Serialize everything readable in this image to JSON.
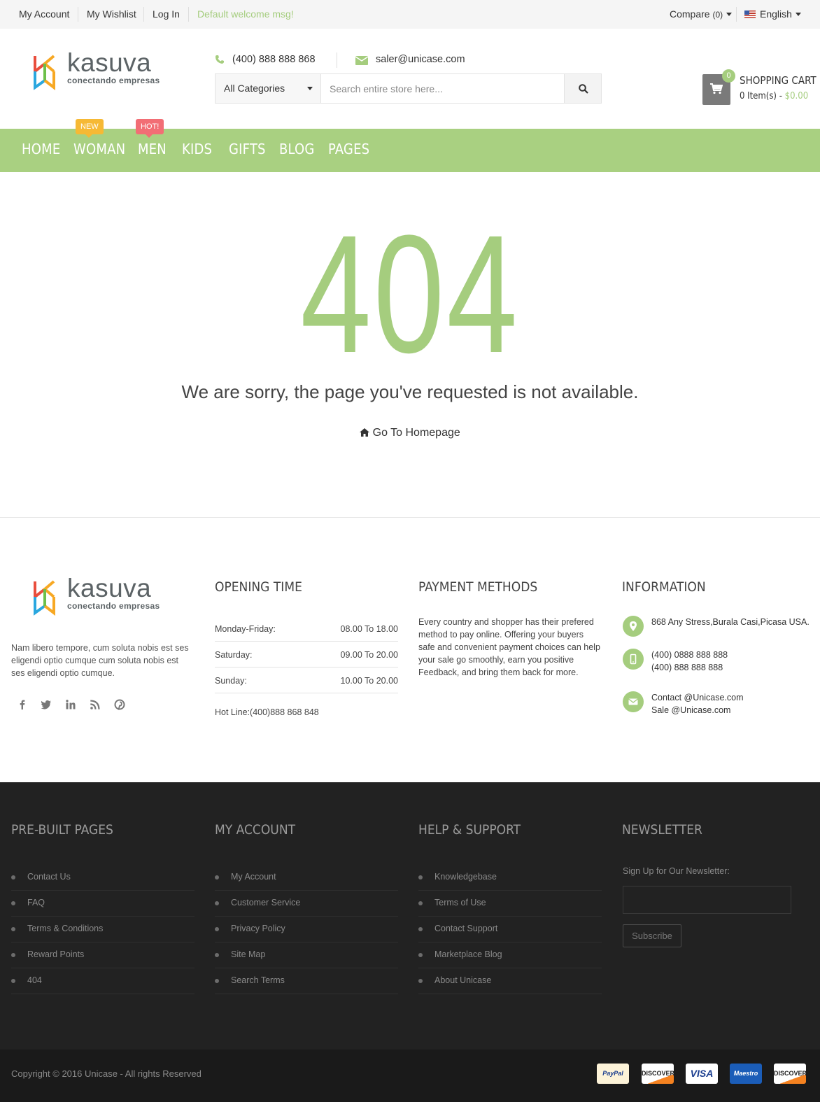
{
  "topbar": {
    "my_account": "My Account",
    "my_wishlist": "My Wishlist",
    "log_in": "Log In",
    "welcome": "Default welcome msg!",
    "compare": "Compare",
    "compare_count": "(0)",
    "language": "English"
  },
  "header": {
    "logo_word": "kasuva",
    "logo_tagline": "conectando empresas",
    "phone": "(400) 888 888 868",
    "email": "saler@unicase.com",
    "category_select": "All Categories",
    "search_placeholder": "Search entire store here...",
    "cart_count": "0",
    "cart_title": "SHOPPING CART",
    "cart_items": "0 Item(s)",
    "cart_dash": " - ",
    "cart_total": "$0.00"
  },
  "nav": {
    "items": [
      "HOME",
      "WOMAN",
      "MEN",
      "KIDS",
      "GIFTS",
      "BLOG",
      "PAGES"
    ],
    "badge_new": "NEW",
    "badge_hot": "HOT!"
  },
  "error": {
    "code": "404",
    "message": "We are sorry, the page you've requested is not available.",
    "home_link": "Go To Homepage"
  },
  "footer_mid": {
    "about": "Nam libero tempore, cum soluta nobis est ses eligendi optio cumque cum soluta nobis est ses eligendi optio cumque.",
    "social_icons": [
      "facebook-icon",
      "twitter-icon",
      "linkedin-icon",
      "rss-icon",
      "pinterest-icon"
    ],
    "opening_title": "OPENING TIME",
    "hours": [
      {
        "day": "Monday-Friday:",
        "time": "08.00 To 18.00"
      },
      {
        "day": "Saturday:",
        "time": "09.00 To 20.00"
      },
      {
        "day": "Sunday:",
        "time": "10.00 To 20.00"
      }
    ],
    "hotline": "Hot Line:(400)888 868 848",
    "payment_title": "PAYMENT METHODS",
    "payment_text": "Every country and shopper has their prefered method to pay online. Offering your buyers safe and convenient payment choices can help your sale go smoothly, earn you positive Feedback, and bring them back for more.",
    "info_title": "INFORMATION",
    "address": "868 Any Stress,Burala Casi,Picasa USA.",
    "phone1": "(400) 0888 888 888",
    "phone2": "(400) 888 888 888",
    "contact_email": "Contact @Unicase.com",
    "sale_email": "Sale @Unicase.com"
  },
  "footer_dark": {
    "prebuilt_title": "PRE-BUILT PAGES",
    "prebuilt": [
      "Contact Us",
      "FAQ",
      "Terms & Conditions",
      "Reward Points",
      "404"
    ],
    "account_title": "MY ACCOUNT",
    "account": [
      "My Account",
      "Customer Service",
      "Privacy Policy",
      "Site Map",
      "Search Terms"
    ],
    "help_title": "HELP & SUPPORT",
    "help": [
      "Knowledgebase",
      "Terms of Use",
      "Contact Support",
      "Marketplace Blog",
      "About Unicase"
    ],
    "newsletter_title": "NEWSLETTER",
    "newsletter_label": "Sign Up for Our Newsletter:",
    "subscribe": "Subscribe"
  },
  "bottom": {
    "copyright": "Copyright © 2016 Unicase - All rights Reserved",
    "cards": [
      "PayPal",
      "DISCOVER",
      "VISA",
      "Maestro",
      "DISCOVER"
    ]
  },
  "colors": {
    "accent": "#a5cd7e",
    "nav": "#a9d081",
    "dark_footer": "#222222",
    "badge_new": "#f6b935",
    "badge_hot": "#f26e75"
  }
}
